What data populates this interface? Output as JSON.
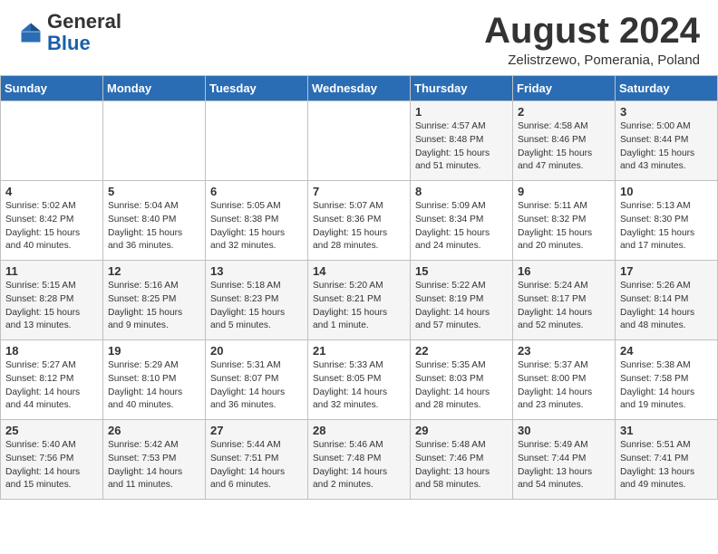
{
  "header": {
    "logo_general": "General",
    "logo_blue": "Blue",
    "month_title": "August 2024",
    "subtitle": "Zelistrzewo, Pomerania, Poland"
  },
  "weekdays": [
    "Sunday",
    "Monday",
    "Tuesday",
    "Wednesday",
    "Thursday",
    "Friday",
    "Saturday"
  ],
  "weeks": [
    [
      {
        "day": "",
        "info": ""
      },
      {
        "day": "",
        "info": ""
      },
      {
        "day": "",
        "info": ""
      },
      {
        "day": "",
        "info": ""
      },
      {
        "day": "1",
        "info": "Sunrise: 4:57 AM\nSunset: 8:48 PM\nDaylight: 15 hours\nand 51 minutes."
      },
      {
        "day": "2",
        "info": "Sunrise: 4:58 AM\nSunset: 8:46 PM\nDaylight: 15 hours\nand 47 minutes."
      },
      {
        "day": "3",
        "info": "Sunrise: 5:00 AM\nSunset: 8:44 PM\nDaylight: 15 hours\nand 43 minutes."
      }
    ],
    [
      {
        "day": "4",
        "info": "Sunrise: 5:02 AM\nSunset: 8:42 PM\nDaylight: 15 hours\nand 40 minutes."
      },
      {
        "day": "5",
        "info": "Sunrise: 5:04 AM\nSunset: 8:40 PM\nDaylight: 15 hours\nand 36 minutes."
      },
      {
        "day": "6",
        "info": "Sunrise: 5:05 AM\nSunset: 8:38 PM\nDaylight: 15 hours\nand 32 minutes."
      },
      {
        "day": "7",
        "info": "Sunrise: 5:07 AM\nSunset: 8:36 PM\nDaylight: 15 hours\nand 28 minutes."
      },
      {
        "day": "8",
        "info": "Sunrise: 5:09 AM\nSunset: 8:34 PM\nDaylight: 15 hours\nand 24 minutes."
      },
      {
        "day": "9",
        "info": "Sunrise: 5:11 AM\nSunset: 8:32 PM\nDaylight: 15 hours\nand 20 minutes."
      },
      {
        "day": "10",
        "info": "Sunrise: 5:13 AM\nSunset: 8:30 PM\nDaylight: 15 hours\nand 17 minutes."
      }
    ],
    [
      {
        "day": "11",
        "info": "Sunrise: 5:15 AM\nSunset: 8:28 PM\nDaylight: 15 hours\nand 13 minutes."
      },
      {
        "day": "12",
        "info": "Sunrise: 5:16 AM\nSunset: 8:25 PM\nDaylight: 15 hours\nand 9 minutes."
      },
      {
        "day": "13",
        "info": "Sunrise: 5:18 AM\nSunset: 8:23 PM\nDaylight: 15 hours\nand 5 minutes."
      },
      {
        "day": "14",
        "info": "Sunrise: 5:20 AM\nSunset: 8:21 PM\nDaylight: 15 hours\nand 1 minute."
      },
      {
        "day": "15",
        "info": "Sunrise: 5:22 AM\nSunset: 8:19 PM\nDaylight: 14 hours\nand 57 minutes."
      },
      {
        "day": "16",
        "info": "Sunrise: 5:24 AM\nSunset: 8:17 PM\nDaylight: 14 hours\nand 52 minutes."
      },
      {
        "day": "17",
        "info": "Sunrise: 5:26 AM\nSunset: 8:14 PM\nDaylight: 14 hours\nand 48 minutes."
      }
    ],
    [
      {
        "day": "18",
        "info": "Sunrise: 5:27 AM\nSunset: 8:12 PM\nDaylight: 14 hours\nand 44 minutes."
      },
      {
        "day": "19",
        "info": "Sunrise: 5:29 AM\nSunset: 8:10 PM\nDaylight: 14 hours\nand 40 minutes."
      },
      {
        "day": "20",
        "info": "Sunrise: 5:31 AM\nSunset: 8:07 PM\nDaylight: 14 hours\nand 36 minutes."
      },
      {
        "day": "21",
        "info": "Sunrise: 5:33 AM\nSunset: 8:05 PM\nDaylight: 14 hours\nand 32 minutes."
      },
      {
        "day": "22",
        "info": "Sunrise: 5:35 AM\nSunset: 8:03 PM\nDaylight: 14 hours\nand 28 minutes."
      },
      {
        "day": "23",
        "info": "Sunrise: 5:37 AM\nSunset: 8:00 PM\nDaylight: 14 hours\nand 23 minutes."
      },
      {
        "day": "24",
        "info": "Sunrise: 5:38 AM\nSunset: 7:58 PM\nDaylight: 14 hours\nand 19 minutes."
      }
    ],
    [
      {
        "day": "25",
        "info": "Sunrise: 5:40 AM\nSunset: 7:56 PM\nDaylight: 14 hours\nand 15 minutes."
      },
      {
        "day": "26",
        "info": "Sunrise: 5:42 AM\nSunset: 7:53 PM\nDaylight: 14 hours\nand 11 minutes."
      },
      {
        "day": "27",
        "info": "Sunrise: 5:44 AM\nSunset: 7:51 PM\nDaylight: 14 hours\nand 6 minutes."
      },
      {
        "day": "28",
        "info": "Sunrise: 5:46 AM\nSunset: 7:48 PM\nDaylight: 14 hours\nand 2 minutes."
      },
      {
        "day": "29",
        "info": "Sunrise: 5:48 AM\nSunset: 7:46 PM\nDaylight: 13 hours\nand 58 minutes."
      },
      {
        "day": "30",
        "info": "Sunrise: 5:49 AM\nSunset: 7:44 PM\nDaylight: 13 hours\nand 54 minutes."
      },
      {
        "day": "31",
        "info": "Sunrise: 5:51 AM\nSunset: 7:41 PM\nDaylight: 13 hours\nand 49 minutes."
      }
    ]
  ]
}
